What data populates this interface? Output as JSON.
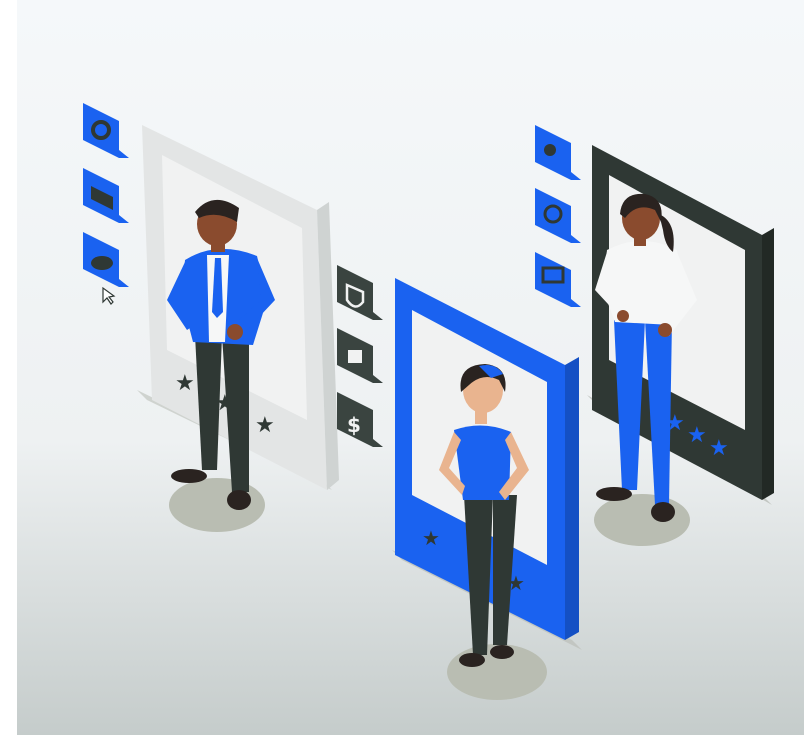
{
  "scene": {
    "description_name": "user-profile-cards-illustration",
    "colors": {
      "background_top": "#f4f7f9",
      "background_bottom": "#c9cfcf",
      "brand_blue": "#1a62f0",
      "panel_light": "#e8eaea",
      "panel_dark": "#2f3834",
      "shadow": "#b9bdb2",
      "skin_dark": "#8a4b2e",
      "skin_light": "#e9b48f",
      "hair": "#2a2320",
      "pants": "#2f3834",
      "shirt_white": "#f6f7f7"
    },
    "icons_left": [
      "gear-icon",
      "envelope-icon",
      "cloud-icon"
    ],
    "icons_middle": [
      "shield-icon",
      "lock-icon",
      "dollar-icon"
    ],
    "icons_right": [
      "users-icon",
      "globe-icon",
      "chat-icon"
    ],
    "cursor": "pointer-cursor-icon"
  }
}
